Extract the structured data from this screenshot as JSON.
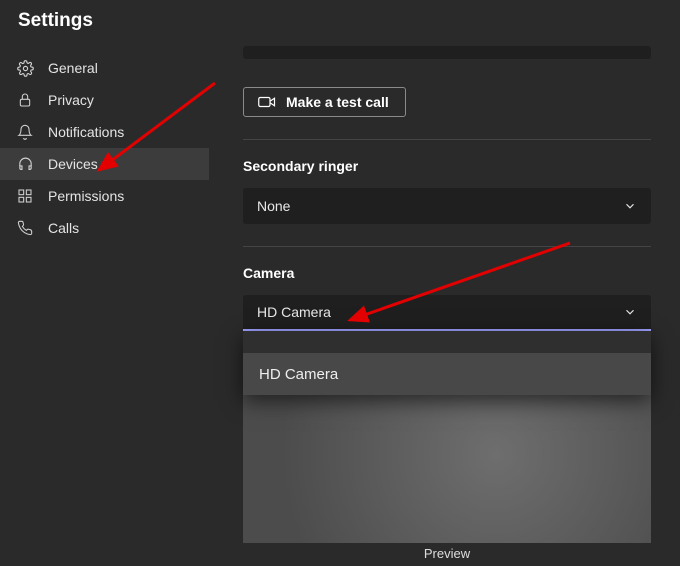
{
  "window": {
    "title": "Settings"
  },
  "sidebar": {
    "items": [
      {
        "label": "General"
      },
      {
        "label": "Privacy"
      },
      {
        "label": "Notifications"
      },
      {
        "label": "Devices"
      },
      {
        "label": "Permissions"
      },
      {
        "label": "Calls"
      }
    ]
  },
  "main": {
    "test_call_label": "Make a test call",
    "secondary_ringer": {
      "label": "Secondary ringer",
      "value": "None"
    },
    "camera": {
      "label": "Camera",
      "value": "HD Camera",
      "options": [
        "HD Camera"
      ],
      "preview_label": "Preview"
    }
  }
}
